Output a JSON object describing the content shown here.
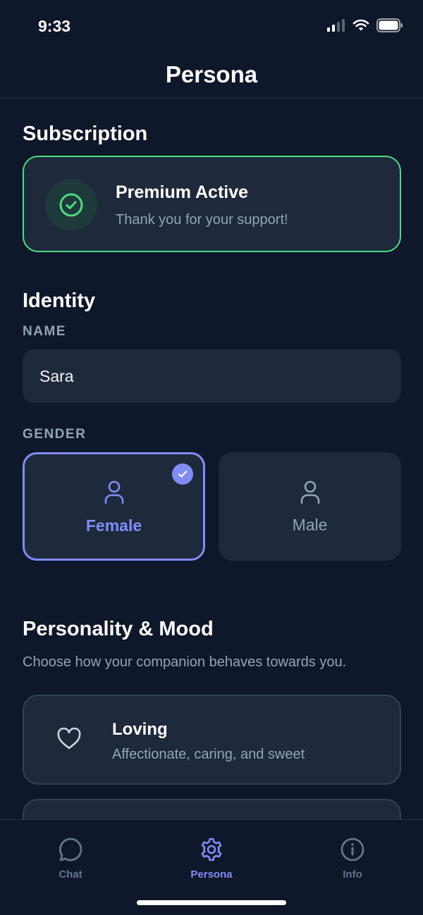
{
  "status_bar": {
    "time": "9:33"
  },
  "header": {
    "title": "Persona"
  },
  "subscription": {
    "section_title": "Subscription",
    "status_title": "Premium Active",
    "status_subtitle": "Thank you for your support!"
  },
  "identity": {
    "section_title": "Identity",
    "name_label": "NAME",
    "name_value": "Sara",
    "gender_label": "GENDER",
    "gender_options": [
      {
        "label": "Female",
        "selected": true
      },
      {
        "label": "Male",
        "selected": false
      }
    ]
  },
  "personality": {
    "section_title": "Personality & Mood",
    "description": "Choose how your companion behaves towards you.",
    "options": [
      {
        "title": "Loving",
        "subtitle": "Affectionate, caring, and sweet",
        "icon": "heart-icon"
      }
    ]
  },
  "tab_bar": {
    "items": [
      {
        "label": "Chat",
        "icon": "chat-bubble-icon",
        "active": false
      },
      {
        "label": "Persona",
        "icon": "gear-icon",
        "active": true
      },
      {
        "label": "Info",
        "icon": "info-icon",
        "active": false
      }
    ]
  },
  "colors": {
    "background": "#0f172a",
    "card": "#1e293b",
    "accent": "#818cf8",
    "success": "#4ade80",
    "muted": "#94a3b8"
  }
}
